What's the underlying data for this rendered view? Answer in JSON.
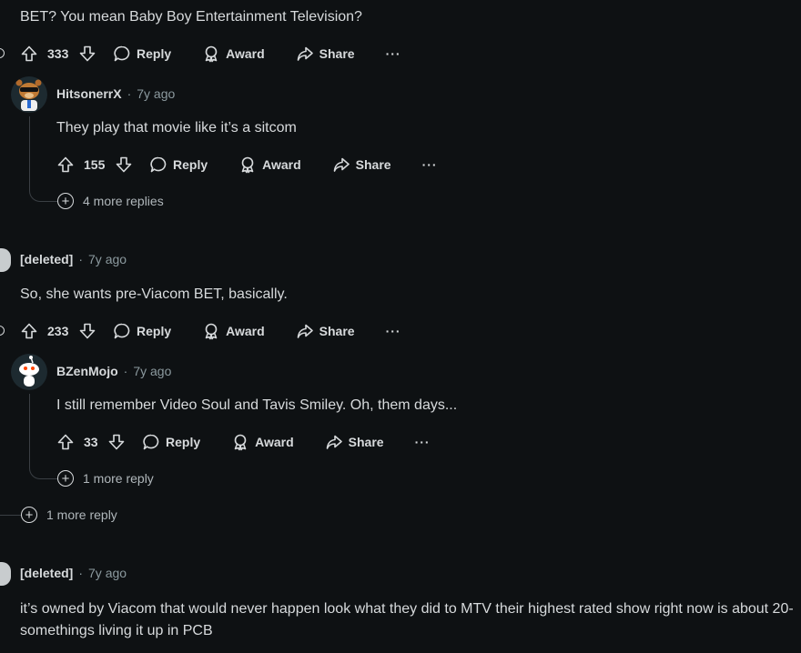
{
  "comment1": {
    "text": "BET? You mean Baby Boy Entertainment Television?",
    "score": "333",
    "reply": "Reply",
    "award": "Award",
    "share": "Share",
    "more": "···"
  },
  "reply1": {
    "author": "HitsonerrX",
    "sep": "·",
    "time": "7y ago",
    "text": "They play that movie like it’s a sitcom",
    "score": "155",
    "reply": "Reply",
    "award": "Award",
    "share": "Share",
    "more": "···",
    "more_replies": "4 more replies"
  },
  "comment2": {
    "author": "[deleted]",
    "sep": "·",
    "time": "7y ago",
    "text": "So, she wants pre-Viacom BET, basically.",
    "score": "233",
    "reply": "Reply",
    "award": "Award",
    "share": "Share",
    "more": "···"
  },
  "reply2": {
    "author": "BZenMojo",
    "sep": "·",
    "time": "7y ago",
    "text": "I still remember Video Soul and Tavis Smiley. Oh, them days...",
    "score": "33",
    "reply": "Reply",
    "award": "Award",
    "share": "Share",
    "more": "···",
    "more_replies": "1 more reply"
  },
  "comment2_more": "1 more reply",
  "comment3": {
    "author": "[deleted]",
    "sep": "·",
    "time": "7y ago",
    "text": "it’s owned by Viacom that would never happen look what they did to MTV their highest rated show right now is about 20-somethings living it up in PCB"
  },
  "colors": {
    "background": "#0e1113",
    "text": "#d7dadc",
    "muted": "#8c9a9f",
    "thread": "#3a3f44"
  },
  "icons": [
    "upvote-icon",
    "downvote-icon",
    "comment-icon",
    "award-icon",
    "share-icon",
    "more-icon",
    "plus-circle-icon"
  ]
}
